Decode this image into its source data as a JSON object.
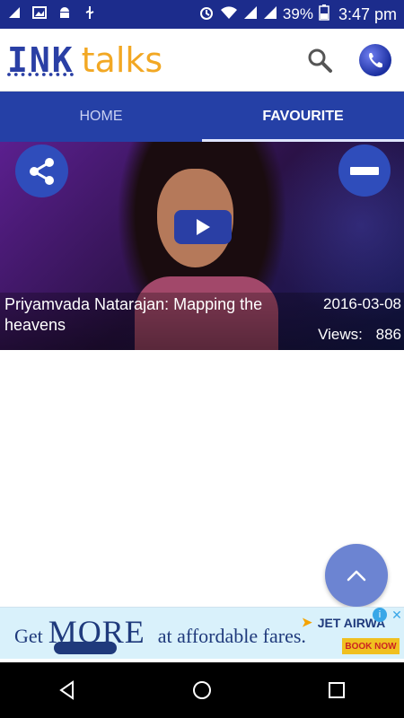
{
  "status_bar": {
    "icons_left": [
      "notification-icon",
      "image-icon",
      "android-icon",
      "usb-icon"
    ],
    "battery_percent": "39%",
    "time": "3:47 pm"
  },
  "app": {
    "logo": {
      "ink": "INK",
      "talks": "talks"
    },
    "search_icon": "search-icon",
    "phone_icon": "phone-icon"
  },
  "tabs": [
    {
      "label": "HOME",
      "active": false
    },
    {
      "label": "FAVOURITE",
      "active": true
    }
  ],
  "video": {
    "title": "Priyamvada Natarajan: Mapping the heavens",
    "date": "2016-03-08",
    "views_label": "Views:",
    "views_count": "886"
  },
  "ad": {
    "get": "Get",
    "more": "MORE",
    "fares": "at affordable fares.",
    "brand": "JET AIRWA",
    "book_now": "BOOK NOW"
  },
  "colors": {
    "status_bar": "#1c2c8c",
    "tab_bar": "#2540a6",
    "accent": "#2f4dbb",
    "logo_ink": "#2a3fa5",
    "logo_talks": "#f2a824"
  }
}
